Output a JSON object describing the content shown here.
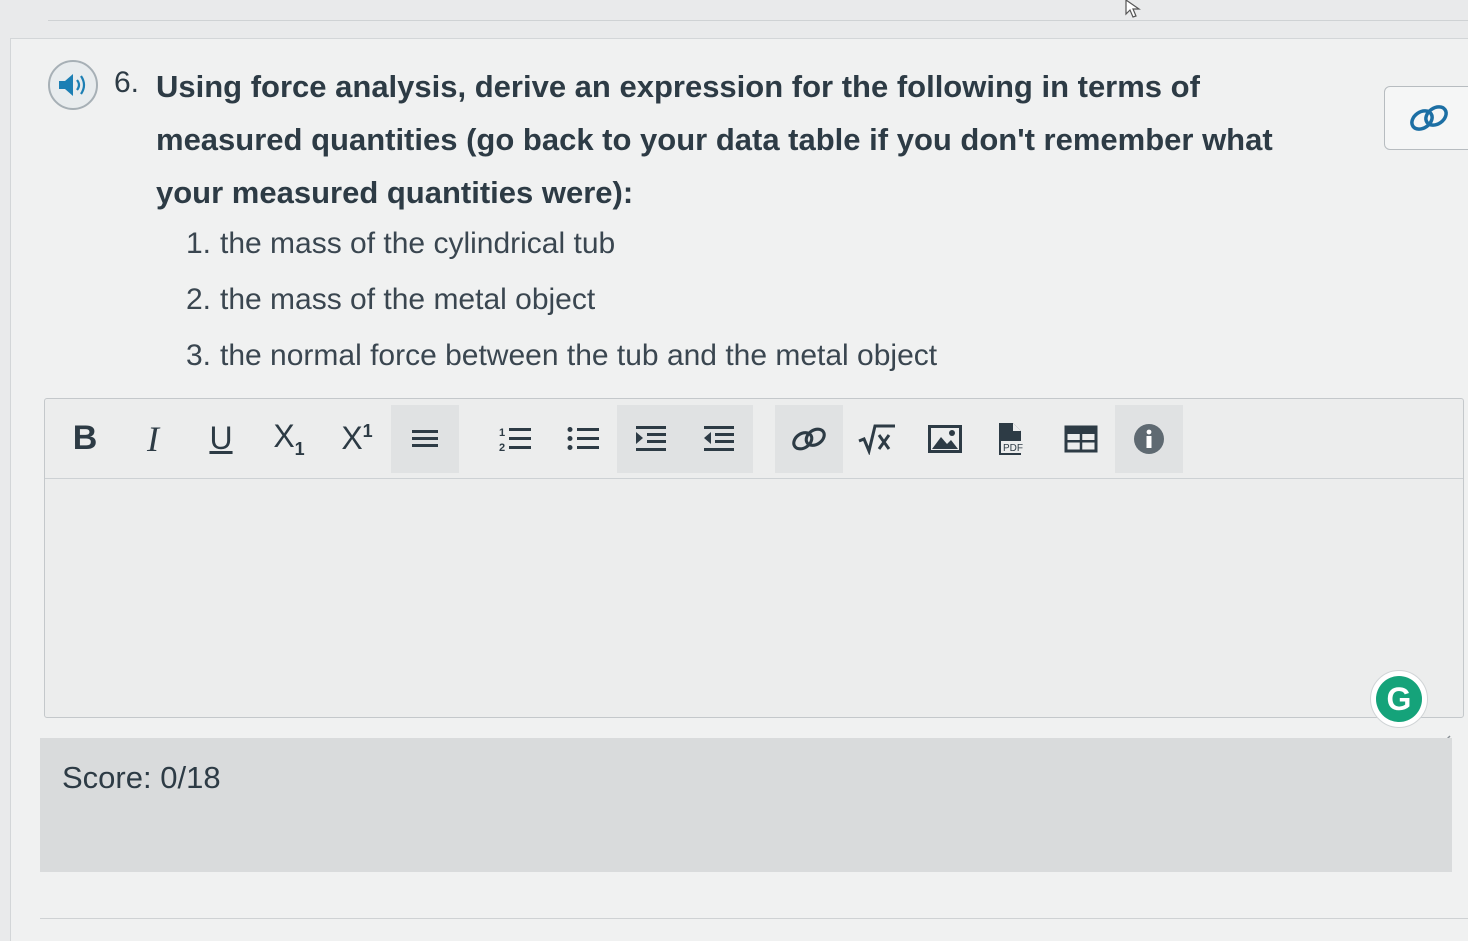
{
  "question": {
    "number": "6.",
    "text": "Using force analysis, derive an expression for the following in terms of measured quantities (go back to your data table if you don't remember what your measured quantities were):",
    "items": [
      {
        "num": "1.",
        "text": "the mass of the cylindrical tub"
      },
      {
        "num": "2.",
        "text": "the mass of the metal object"
      },
      {
        "num": "3.",
        "text": "the normal force between the tub and the metal object"
      }
    ]
  },
  "toolbar": {
    "bold": "B",
    "italic": "I",
    "underline": "U",
    "subscript": "X",
    "subscript_mark": "1",
    "superscript": "X",
    "superscript_mark": "1",
    "pdf_label": "PDF"
  },
  "grammarly": {
    "letter": "G"
  },
  "score": {
    "label": "Score:",
    "value": "0/18"
  },
  "icons": {
    "speaker": "speaker-icon",
    "link": "link-icon",
    "align": "align-icon",
    "ordered_list": "ordered-list-icon",
    "unordered_list": "unordered-list-icon",
    "indent": "indent-icon",
    "outdent": "outdent-icon",
    "equation": "square-root-icon",
    "image": "image-icon",
    "pdf": "pdf-icon",
    "table": "table-icon",
    "info": "info-icon"
  },
  "colors": {
    "text": "#2d3b45",
    "grammarly": "#15a37a",
    "score_bar": "#d9dbdc"
  }
}
